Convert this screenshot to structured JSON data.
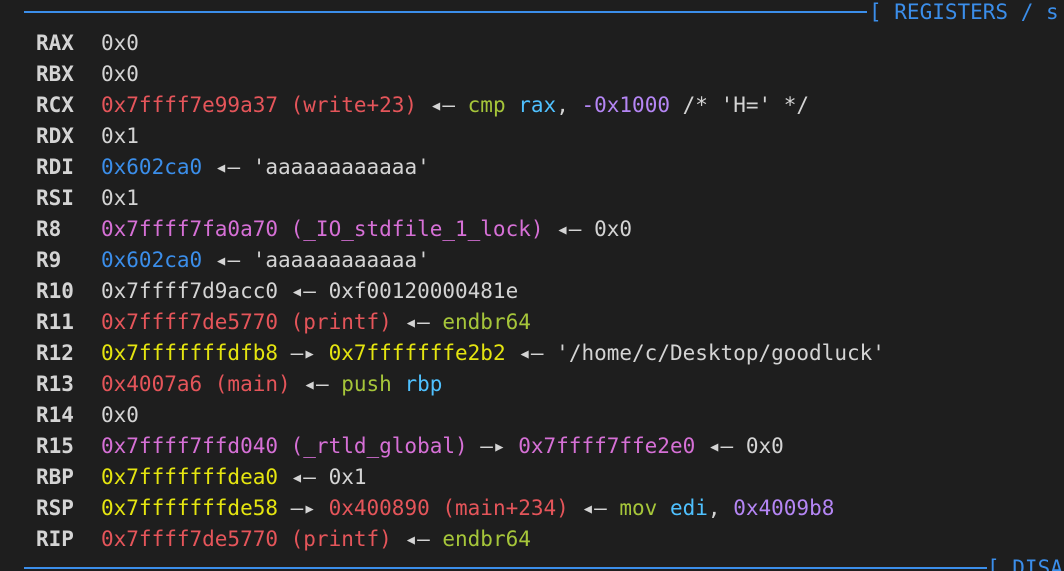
{
  "header": {
    "title": "[ REGISTERS / s"
  },
  "footer": {
    "title": "[ DISA"
  },
  "registers": [
    {
      "name": "RAX",
      "segments": [
        {
          "text": "0x0",
          "color": "plain"
        }
      ]
    },
    {
      "name": "RBX",
      "segments": [
        {
          "text": "0x0",
          "color": "plain"
        }
      ]
    },
    {
      "name": "RCX",
      "segments": [
        {
          "text": "0x7ffff7e99a37 (write+23)",
          "color": "red"
        },
        {
          "text": " ◂— ",
          "color": "plain"
        },
        {
          "text": "cmp",
          "color": "green"
        },
        {
          "text": " ",
          "color": "plain"
        },
        {
          "text": "rax",
          "color": "cyan"
        },
        {
          "text": ", ",
          "color": "plain"
        },
        {
          "text": "-0x1000",
          "color": "violet"
        },
        {
          "text": " /* 'H=' */",
          "color": "plain"
        }
      ]
    },
    {
      "name": "RDX",
      "segments": [
        {
          "text": "0x1",
          "color": "plain"
        }
      ]
    },
    {
      "name": "RDI",
      "segments": [
        {
          "text": "0x602ca0",
          "color": "blue"
        },
        {
          "text": " ◂— 'aaaaaaaaaaaa'",
          "color": "plain"
        }
      ]
    },
    {
      "name": "RSI",
      "segments": [
        {
          "text": "0x1",
          "color": "plain"
        }
      ]
    },
    {
      "name": "R8",
      "segments": [
        {
          "text": "0x7ffff7fa0a70 (_IO_stdfile_1_lock)",
          "color": "purple"
        },
        {
          "text": " ◂— 0x0",
          "color": "plain"
        }
      ]
    },
    {
      "name": "R9",
      "segments": [
        {
          "text": "0x602ca0",
          "color": "blue"
        },
        {
          "text": " ◂— 'aaaaaaaaaaaa'",
          "color": "plain"
        }
      ]
    },
    {
      "name": "R10",
      "segments": [
        {
          "text": "0x7ffff7d9acc0 ◂— 0xf00120000481e",
          "color": "plain"
        }
      ]
    },
    {
      "name": "R11",
      "segments": [
        {
          "text": "0x7ffff7de5770 (printf)",
          "color": "red"
        },
        {
          "text": " ◂— ",
          "color": "plain"
        },
        {
          "text": "endbr64",
          "color": "green"
        }
      ]
    },
    {
      "name": "R12",
      "segments": [
        {
          "text": "0x7fffffffdfb8",
          "color": "yellow"
        },
        {
          "text": " —▸ ",
          "color": "plain"
        },
        {
          "text": "0x7fffffffe2b2",
          "color": "yellow"
        },
        {
          "text": " ◂— '/home/c/Desktop/goodluck'",
          "color": "plain"
        }
      ]
    },
    {
      "name": "R13",
      "segments": [
        {
          "text": "0x4007a6 (main)",
          "color": "red"
        },
        {
          "text": " ◂— ",
          "color": "plain"
        },
        {
          "text": "push",
          "color": "green"
        },
        {
          "text": " ",
          "color": "plain"
        },
        {
          "text": "rbp",
          "color": "cyan"
        }
      ]
    },
    {
      "name": "R14",
      "segments": [
        {
          "text": "0x0",
          "color": "plain"
        }
      ]
    },
    {
      "name": "R15",
      "segments": [
        {
          "text": "0x7ffff7ffd040 (_rtld_global)",
          "color": "purple"
        },
        {
          "text": " —▸ ",
          "color": "plain"
        },
        {
          "text": "0x7ffff7ffe2e0",
          "color": "purple"
        },
        {
          "text": " ◂— 0x0",
          "color": "plain"
        }
      ]
    },
    {
      "name": "RBP",
      "segments": [
        {
          "text": "0x7fffffffdea0",
          "color": "yellow"
        },
        {
          "text": " ◂— 0x1",
          "color": "plain"
        }
      ]
    },
    {
      "name": "RSP",
      "segments": [
        {
          "text": "0x7fffffffde58",
          "color": "yellow"
        },
        {
          "text": " —▸ ",
          "color": "plain"
        },
        {
          "text": "0x400890 (main+234)",
          "color": "red"
        },
        {
          "text": " ◂— ",
          "color": "plain"
        },
        {
          "text": "mov",
          "color": "green"
        },
        {
          "text": " ",
          "color": "plain"
        },
        {
          "text": "edi",
          "color": "cyan"
        },
        {
          "text": ", ",
          "color": "plain"
        },
        {
          "text": "0x4009b8",
          "color": "violet"
        }
      ]
    },
    {
      "name": "RIP",
      "segments": [
        {
          "text": "0x7ffff7de5770 (printf)",
          "color": "red"
        },
        {
          "text": " ◂— ",
          "color": "plain"
        },
        {
          "text": "endbr64",
          "color": "green"
        }
      ]
    }
  ],
  "colors": {
    "background": "#1e1e1e",
    "plain": "#d4d4d4",
    "red": "#e5555a",
    "blue": "#3b8eea",
    "purple": "#d670d6",
    "yellow": "#e5e510",
    "green": "#a6c63a",
    "cyan": "#4fc1ff",
    "violet": "#b586f5"
  }
}
